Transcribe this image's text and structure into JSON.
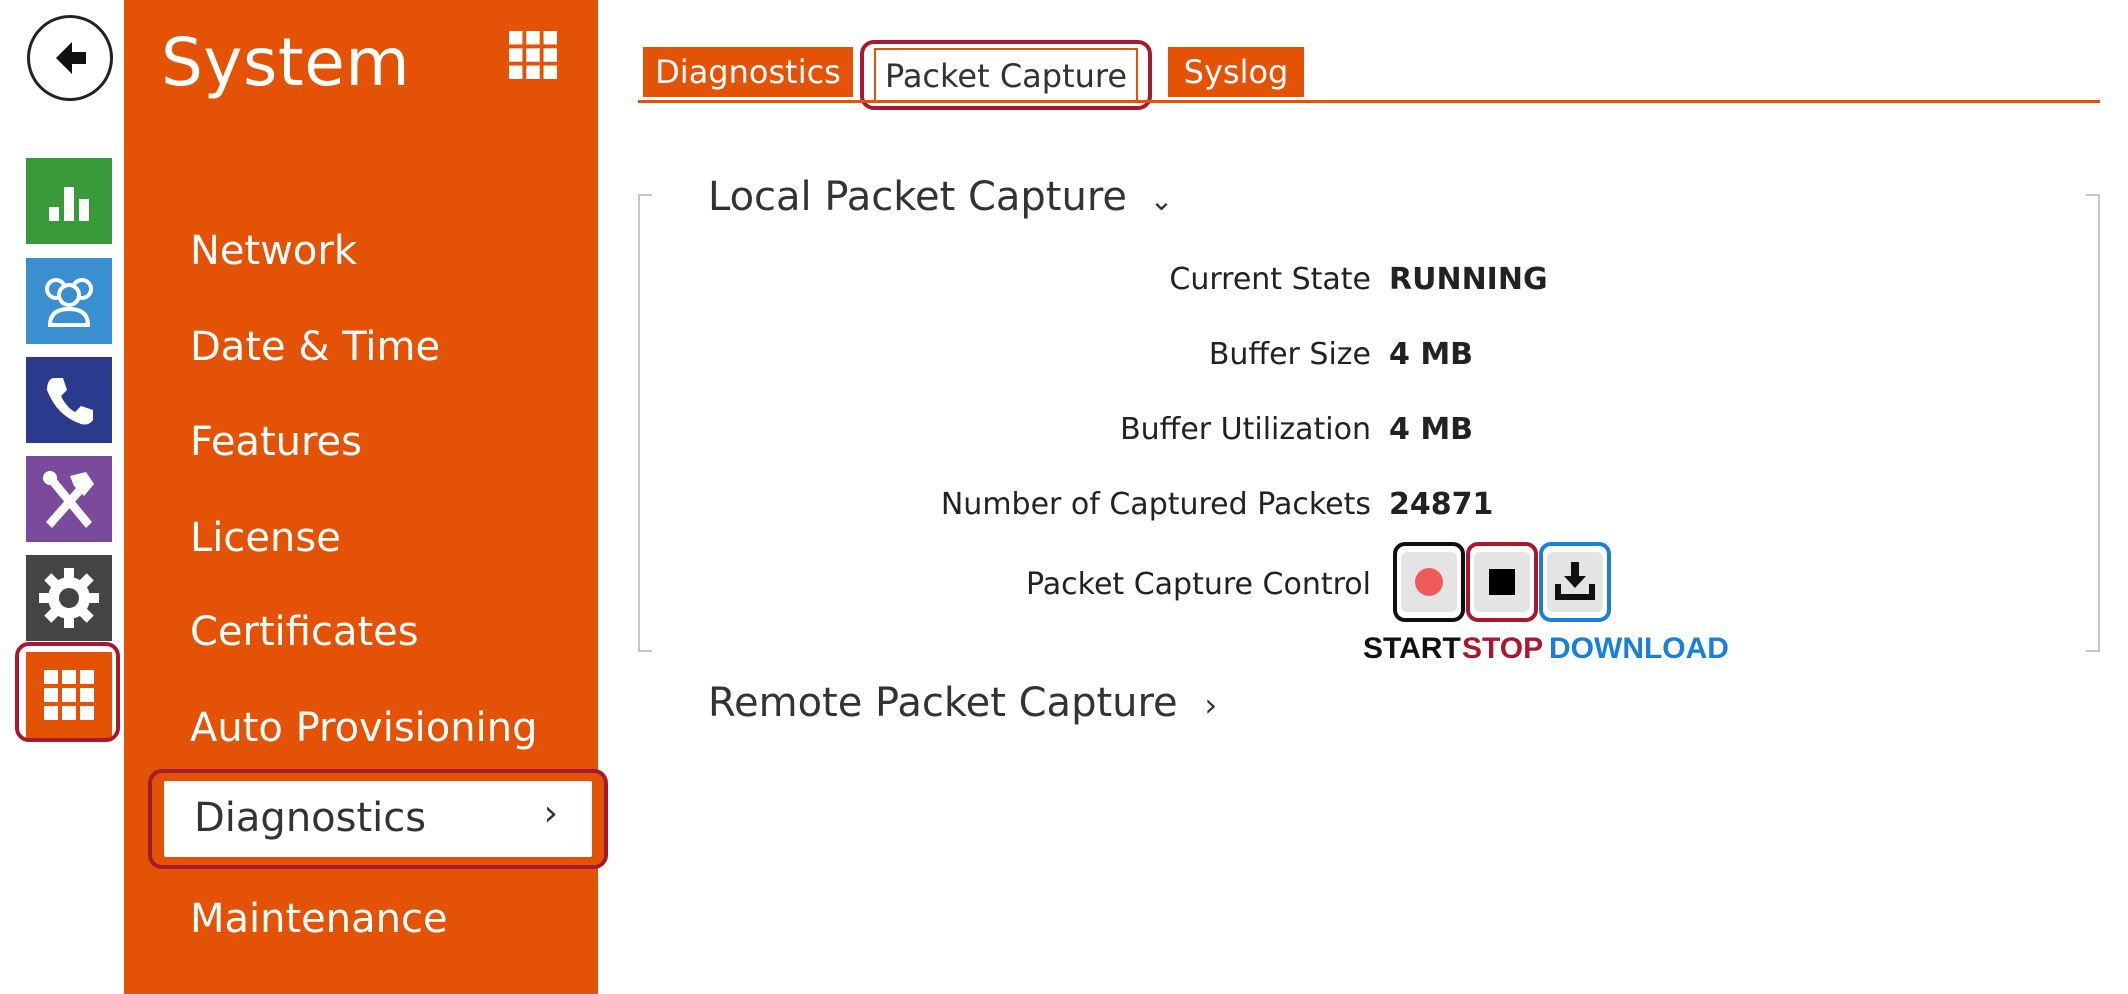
{
  "sidebar": {
    "title": "System",
    "items": [
      {
        "label": "Network"
      },
      {
        "label": "Date & Time"
      },
      {
        "label": "Features"
      },
      {
        "label": "License"
      },
      {
        "label": "Certificates"
      },
      {
        "label": "Auto Provisioning"
      },
      {
        "label": "Diagnostics",
        "active": true
      },
      {
        "label": "Maintenance"
      }
    ]
  },
  "rail": {
    "icons": [
      "back-arrow-icon",
      "bar-chart-icon",
      "users-icon",
      "phone-icon",
      "tools-icon",
      "gear-icon",
      "grid-icon"
    ],
    "colors": {
      "chart": "#3a9a3a",
      "users": "#3a8fd1",
      "phone": "#2b3a8c",
      "tools": "#7a4a9c",
      "gear": "#444444",
      "grid": "#e35205"
    }
  },
  "tabs": [
    {
      "label": "Diagnostics"
    },
    {
      "label": "Packet Capture",
      "active": true
    },
    {
      "label": "Syslog"
    }
  ],
  "local_capture": {
    "title": "Local Packet Capture",
    "fields": [
      {
        "label": "Current State",
        "value": "RUNNING"
      },
      {
        "label": "Buffer Size",
        "value": "4 MB"
      },
      {
        "label": "Buffer Utilization",
        "value": "4 MB"
      },
      {
        "label": "Number of Captured Packets",
        "value": "24871"
      }
    ],
    "control_label": "Packet Capture Control",
    "legend": {
      "start": "START",
      "stop": "STOP",
      "download": "DOWNLOAD"
    }
  },
  "remote_capture": {
    "title": "Remote Packet Capture"
  },
  "colors": {
    "brand_orange": "#e35205",
    "highlight_red": "#a6192e",
    "highlight_blue": "#1a7fd6",
    "record_red": "#f05a5a"
  }
}
